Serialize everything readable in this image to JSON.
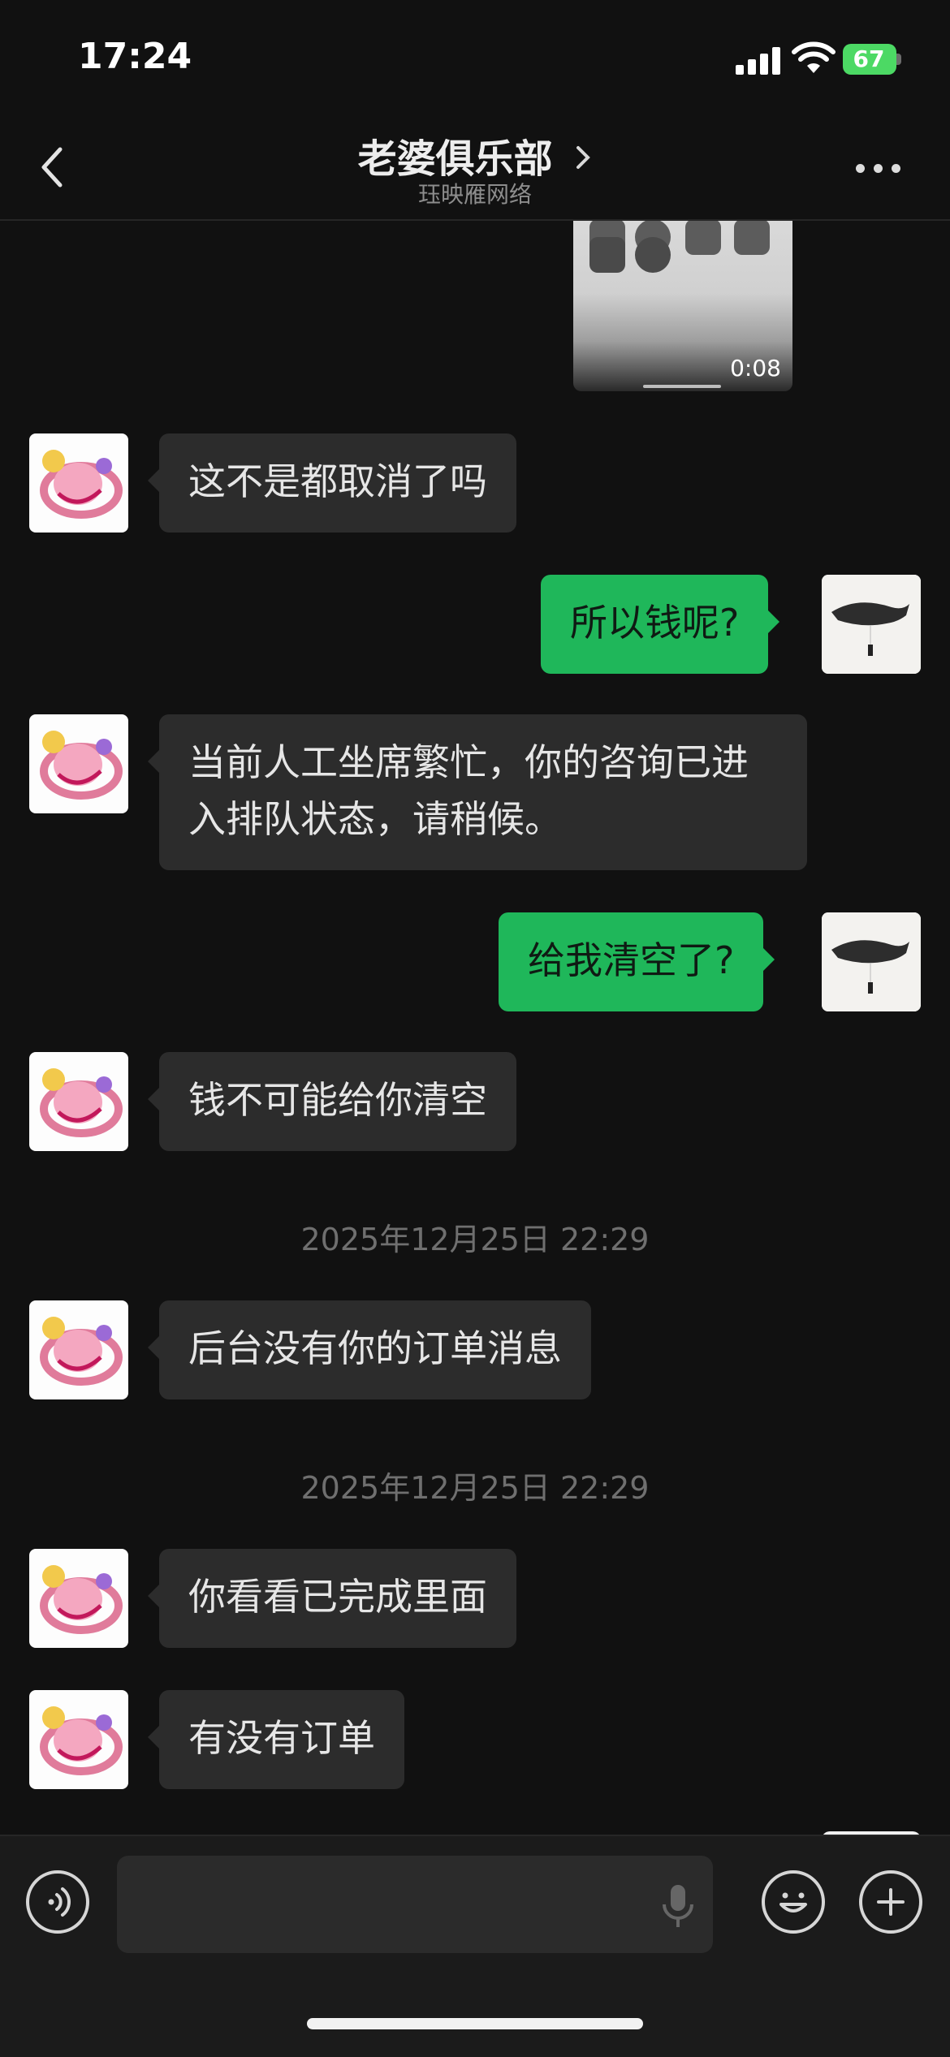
{
  "status_bar": {
    "time": "17:24",
    "battery": "67"
  },
  "header": {
    "title": "老婆俱乐部",
    "subtitle": "珏映雁网络"
  },
  "video": {
    "duration": "0:08"
  },
  "messages": [
    {
      "side": "in",
      "text": "这不是都取消了吗"
    },
    {
      "side": "out",
      "text": "所以钱呢?"
    },
    {
      "side": "in",
      "text": "当前人工坐席繁忙，你的咨询已进入排队状态，请稍候。"
    },
    {
      "side": "out",
      "text": "给我清空了?"
    },
    {
      "side": "in",
      "text": "钱不可能给你清空"
    },
    {
      "type": "time",
      "text": "2025年12月25日 22:29"
    },
    {
      "side": "in",
      "text": "后台没有你的订单消息"
    },
    {
      "type": "time",
      "text": "2025年12月25日 22:29"
    },
    {
      "side": "in",
      "text": "你看看已完成里面"
    },
    {
      "side": "in",
      "text": "有没有订单"
    }
  ],
  "colors": {
    "incoming_bubble": "#2c2c2c",
    "outgoing_bubble": "#1fb75a",
    "battery": "#4cd964"
  },
  "icons": [
    "chevron-left-icon",
    "more-icon",
    "voice-icon",
    "mic-icon",
    "emoji-icon",
    "plus-icon"
  ]
}
